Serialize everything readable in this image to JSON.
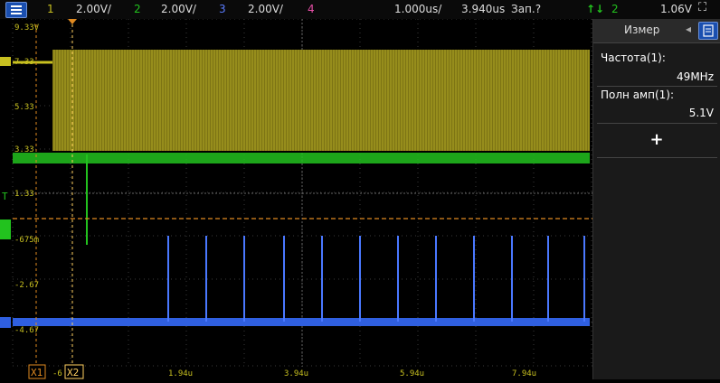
{
  "toolbar": {
    "ch1_num": "1",
    "ch1_scale": "2.00V/",
    "ch2_num": "2",
    "ch2_scale": "2.00V/",
    "ch3_num": "3",
    "ch3_scale": "2.00V/",
    "ch4_num": "4",
    "timebase": "1.000us/",
    "delay": "3.940us",
    "run_status": "Зап.?",
    "trigger_source": "2",
    "trigger_level": "1.06V"
  },
  "colors": {
    "ch1": "#c8c020",
    "ch2": "#22c21e",
    "ch3": "#2f5fe0",
    "ch4": "#e84fa8",
    "accent": "#1a4fb0"
  },
  "voltage_labels": [
    "9.33V",
    "7.33",
    "5.33",
    "3.33",
    "1.33",
    "-675m",
    "-2.67",
    "-4.67"
  ],
  "time_labels": [
    "-6",
    "1.94u",
    "3.94u",
    "5.94u",
    "7.94u"
  ],
  "cursors": {
    "x1_label": "X1",
    "x2_label": "X2"
  },
  "panel": {
    "title": "Измер",
    "measurements": [
      {
        "label": "Частота(1):",
        "value": "49MHz"
      },
      {
        "label": "Полн амп(1):",
        "value": "5.1V"
      }
    ],
    "add_label": "+"
  },
  "icons": {
    "menu": "menu-icon",
    "trigger_edge": "trigger-rising-edge-icon",
    "fit": "fit-screen-icon",
    "panel": "panel-list-icon"
  }
}
